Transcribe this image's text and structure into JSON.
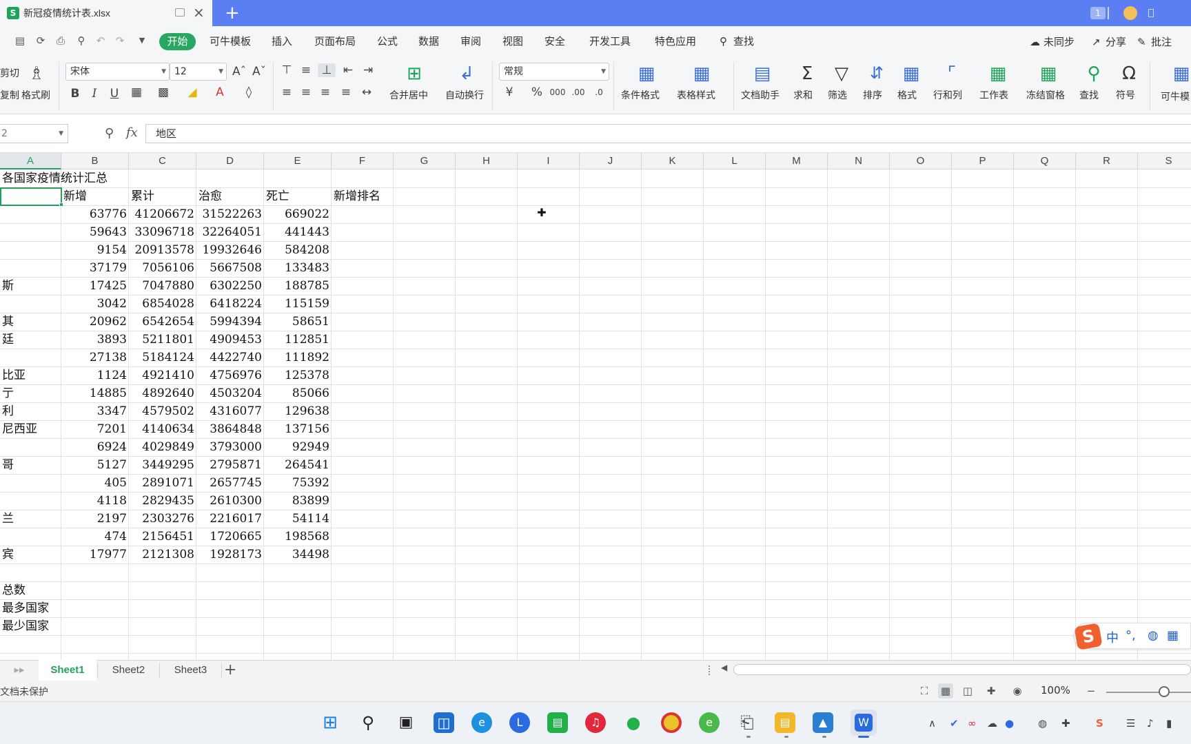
{
  "window": {
    "doc_title": "新冠疫情统计表.xlsx",
    "doc_logo": "S",
    "new_tab": "+",
    "badge": "1"
  },
  "quick_access": {
    "icons": [
      "save-icon",
      "cloud-save-icon",
      "print-icon",
      "print-preview-icon",
      "undo-icon",
      "redo-icon",
      "customize-icon"
    ]
  },
  "menu": {
    "items": [
      "开始",
      "可牛模板",
      "插入",
      "页面布局",
      "公式",
      "数据",
      "审阅",
      "视图",
      "安全",
      "开发工具",
      "特色应用",
      "查找"
    ],
    "right": [
      "未同步",
      "分享",
      "批注"
    ]
  },
  "ribbon": {
    "cut": "剪切",
    "copy": "复制",
    "format_painter": "格式刷",
    "font_name": "宋体",
    "font_size": "12",
    "merge_center": "合并居中",
    "wrap_text": "自动换行",
    "number_format": "常规",
    "conditional_format": "条件格式",
    "table_style": "表格样式",
    "doc_assistant": "文档助手",
    "sum": "求和",
    "filter": "筛选",
    "sort": "排序",
    "format": "格式",
    "row_col": "行和列",
    "worksheet": "工作表",
    "freeze": "冻结窗格",
    "find": "查找",
    "symbol": "符号",
    "more": "可牛模"
  },
  "formula_bar": {
    "name_box": "2",
    "fx": "fx",
    "value": "地区"
  },
  "columns": [
    "A",
    "B",
    "C",
    "D",
    "E",
    "F",
    "G",
    "H",
    "I",
    "J",
    "K",
    "L",
    "M",
    "N",
    "O",
    "P",
    "Q",
    "R",
    "S"
  ],
  "sheet": {
    "title": "各国家疫情统计汇总",
    "headers": [
      "新增",
      "累计",
      "治愈",
      "死亡",
      "新增排名"
    ],
    "rows": [
      {
        "a": "",
        "b": "63776",
        "c": "41206672",
        "d": "31522263",
        "e": "669022"
      },
      {
        "a": "",
        "b": "59643",
        "c": "33096718",
        "d": "32264051",
        "e": "441443"
      },
      {
        "a": "",
        "b": "9154",
        "c": "20913578",
        "d": "19932646",
        "e": "584208"
      },
      {
        "a": "",
        "b": "37179",
        "c": "7056106",
        "d": "5667508",
        "e": "133483"
      },
      {
        "a": "斯",
        "b": "17425",
        "c": "7047880",
        "d": "6302250",
        "e": "188785"
      },
      {
        "a": "",
        "b": "3042",
        "c": "6854028",
        "d": "6418224",
        "e": "115159"
      },
      {
        "a": "其",
        "b": "20962",
        "c": "6542654",
        "d": "5994394",
        "e": "58651"
      },
      {
        "a": "廷",
        "b": "3893",
        "c": "5211801",
        "d": "4909453",
        "e": "112851"
      },
      {
        "a": "",
        "b": "27138",
        "c": "5184124",
        "d": "4422740",
        "e": "111892"
      },
      {
        "a": "比亚",
        "b": "1124",
        "c": "4921410",
        "d": "4756976",
        "e": "125378"
      },
      {
        "a": "亍",
        "b": "14885",
        "c": "4892640",
        "d": "4503204",
        "e": "85066"
      },
      {
        "a": "利",
        "b": "3347",
        "c": "4579502",
        "d": "4316077",
        "e": "129638"
      },
      {
        "a": "尼西亚",
        "b": "7201",
        "c": "4140634",
        "d": "3864848",
        "e": "137156"
      },
      {
        "a": "",
        "b": "6924",
        "c": "4029849",
        "d": "3793000",
        "e": "92949"
      },
      {
        "a": "哥",
        "b": "5127",
        "c": "3449295",
        "d": "2795871",
        "e": "264541"
      },
      {
        "a": "",
        "b": "405",
        "c": "2891071",
        "d": "2657745",
        "e": "75392"
      },
      {
        "a": "",
        "b": "4118",
        "c": "2829435",
        "d": "2610300",
        "e": "83899"
      },
      {
        "a": "兰",
        "b": "2197",
        "c": "2303276",
        "d": "2216017",
        "e": "54114"
      },
      {
        "a": "",
        "b": "474",
        "c": "2156451",
        "d": "1720665",
        "e": "198568"
      },
      {
        "a": "宾",
        "b": "17977",
        "c": "2121308",
        "d": "1928173",
        "e": "34498"
      }
    ],
    "footer_labels": [
      "总数",
      "最多国家",
      "最少国家"
    ]
  },
  "sheet_tabs": [
    "Sheet1",
    "Sheet2",
    "Sheet3"
  ],
  "status": {
    "protect_text": "文档未保护",
    "zoom": "100%"
  },
  "ime": {
    "lang": "中",
    "punct": "°,"
  },
  "taskbar": {
    "apps": [
      "start-icon",
      "search-icon",
      "task-view-icon",
      "widgets-icon",
      "edge-icon",
      "app-l-icon",
      "app-green-icon",
      "netease-music-icon",
      "wechat-icon",
      "chrome-icon",
      "ie-icon",
      "computer-icon",
      "file-explorer-icon",
      "photos-icon",
      "wps-icon"
    ]
  },
  "colors": {
    "accent": "#1fa35a",
    "titlebar": "#5b7ef0",
    "ribbon_bg": "#f5f6f8"
  }
}
